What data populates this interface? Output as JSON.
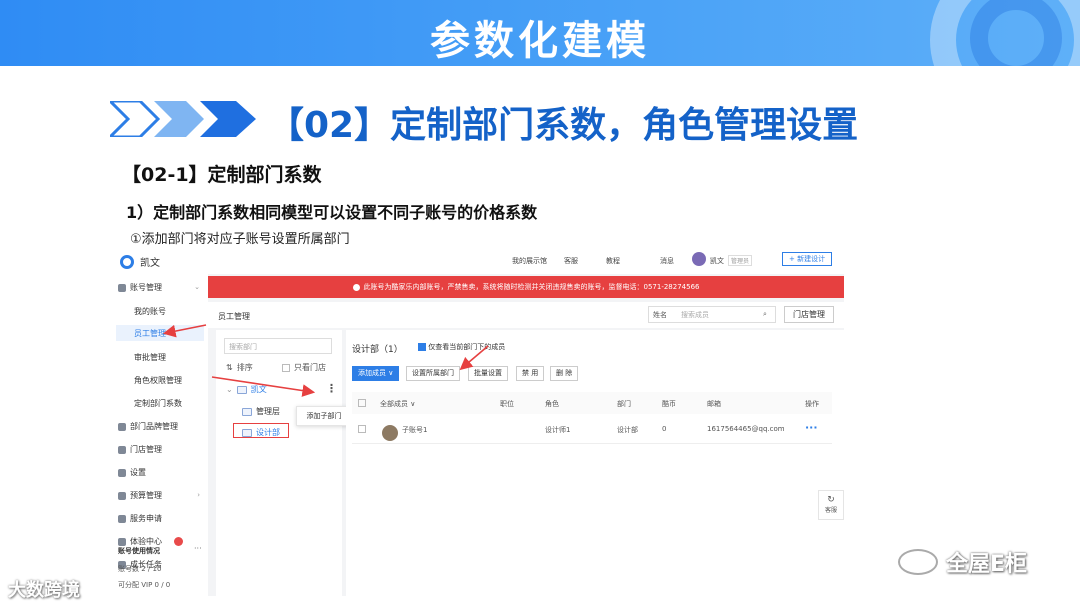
{
  "banner": {
    "title": "参数化建模"
  },
  "heading": {
    "main": "【02】定制部门系数，角色管理设置",
    "section": "【02-1】定制部门系数",
    "subsection": "1）定制部门系数相同模型可以设置不同子账号的价格系数",
    "step": "①添加部门将对应子账号设置所属部门"
  },
  "app": {
    "brand": "凯文",
    "sidebar": {
      "items": [
        {
          "label": "账号管理",
          "expanded": true
        },
        {
          "label": "部门品牌管理"
        },
        {
          "label": "门店管理"
        },
        {
          "label": "设置"
        },
        {
          "label": "预算管理"
        },
        {
          "label": "服务申请"
        },
        {
          "label": "体验中心"
        },
        {
          "label": "成长任务"
        }
      ],
      "sub_items": [
        "我的账号",
        "员工管理",
        "审批管理",
        "角色权限管理",
        "定制部门系数"
      ],
      "usage": {
        "title": "账号使用情况",
        "accounts": "账号数 2 / 10",
        "vip": "可分配 VIP 0 / 0",
        "accounts_fraction": 0.2
      }
    },
    "topbar": {
      "links": [
        "我的展示馆",
        "客服",
        "教程",
        "消息"
      ],
      "user": "凯文",
      "role_tag": "管理员",
      "new_button": "+ 新建设计"
    },
    "alert": "此账号为酷家乐内部账号，严禁售卖，系统将随时检测并关闭违规售卖的账号，监督电话：0571-28274566",
    "page_head": {
      "title": "员工管理",
      "search_type": "姓名",
      "search_placeholder": "搜索成员",
      "store_button": "门店管理"
    },
    "tree": {
      "search_placeholder": "搜索部门",
      "sort_label": "排序",
      "only_store_label": "只看门店",
      "root": "凯文",
      "children": [
        "管理层",
        "设计部"
      ],
      "popup": "添加子部门"
    },
    "main": {
      "title": "设计部（1）",
      "checkbox_label": "仅查看当前部门下的成员",
      "buttons": [
        "添加成员 ∨",
        "设置所属部门",
        "批量设置",
        "禁 用",
        "删 除"
      ],
      "columns": [
        "全部成员 ∨",
        "职位",
        "角色",
        "部门",
        "酷币",
        "邮箱",
        "操作"
      ],
      "rows": [
        {
          "name": "子账号1",
          "position": "",
          "role": "设计师1",
          "dept": "设计部",
          "coins": "0",
          "email": "1617564465@qq.com",
          "action": "···"
        }
      ]
    },
    "service_label": "客服"
  },
  "watermarks": {
    "left": "大数跨境",
    "right": "全屋E柜"
  },
  "colors": {
    "brand_blue": "#1462c8",
    "accent": "#2d7ee6",
    "alert_red": "#e64040",
    "annotation_red": "#e64040"
  }
}
